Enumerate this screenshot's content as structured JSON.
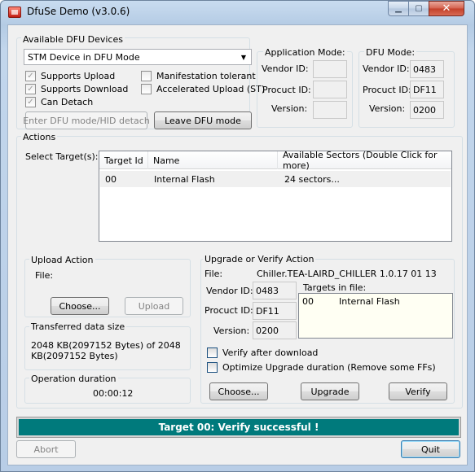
{
  "window": {
    "title": "DfuSe Demo (v3.0.6)"
  },
  "devices": {
    "group_label": "Available DFU Devices",
    "selected_device": "STM Device in DFU Mode",
    "supports_upload": "Supports Upload",
    "supports_download": "Supports Download",
    "can_detach": "Can Detach",
    "manifestation_tolerant": "Manifestation tolerant",
    "accelerated_upload": "Accelerated Upload (ST)",
    "enter_dfu_button": "Enter DFU mode/HID detach",
    "leave_dfu_button": "Leave DFU mode"
  },
  "app_mode": {
    "group_label": "Application Mode:",
    "vendor_id_label": "Vendor ID:",
    "product_id_label": "Procuct ID:",
    "version_label": "Version:",
    "vendor_id": "",
    "product_id": "",
    "version": ""
  },
  "dfu_mode": {
    "group_label": "DFU Mode:",
    "vendor_id_label": "Vendor ID:",
    "product_id_label": "Procuct ID:",
    "version_label": "Version:",
    "vendor_id": "0483",
    "product_id": "DF11",
    "version": "0200"
  },
  "actions": {
    "group_label": "Actions",
    "select_targets_label": "Select Target(s):",
    "columns": [
      "Target Id",
      "Name",
      "Available Sectors (Double Click for more)"
    ],
    "rows": [
      {
        "target_id": "00",
        "name": "Internal Flash",
        "sectors": "24 sectors..."
      }
    ]
  },
  "upload": {
    "group_label": "Upload Action",
    "file_label": "File:",
    "choose_button": "Choose...",
    "upload_button": "Upload"
  },
  "transferred": {
    "group_label": "Transferred data size",
    "text_line1": "2048 KB(2097152 Bytes) of 2048",
    "text_line2": "KB(2097152 Bytes)"
  },
  "duration": {
    "group_label": "Operation duration",
    "value": "00:00:12"
  },
  "upgrade": {
    "group_label": "Upgrade or Verify Action",
    "file_label": "File:",
    "file_value": "Chiller.TEA-LAIRD_CHILLER 1.0.17 01 13",
    "vendor_id_label": "Vendor ID:",
    "product_id_label": "Procuct ID:",
    "version_label": "Version:",
    "vendor_id": "0483",
    "product_id": "DF11",
    "version": "0200",
    "targets_label": "Targets in file:",
    "targets": [
      {
        "id": "00",
        "name": "Internal Flash"
      }
    ],
    "verify_after_download": "Verify after download",
    "optimize_upgrade": "Optimize Upgrade duration (Remove some FFs)",
    "choose_button": "Choose...",
    "upgrade_button": "Upgrade",
    "verify_button": "Verify"
  },
  "status": {
    "message": "Target 00: Verify successful !",
    "color": "#007a7c"
  },
  "footer": {
    "abort_button": "Abort",
    "quit_button": "Quit"
  }
}
